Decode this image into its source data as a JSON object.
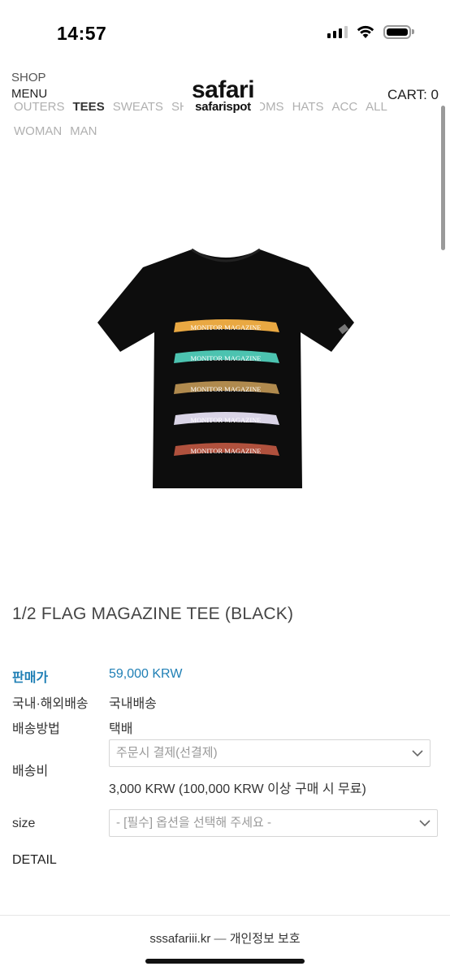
{
  "status_bar": {
    "time": "14:57",
    "icons": [
      "signal-icon",
      "wifi-icon",
      "battery-icon"
    ]
  },
  "header": {
    "shop_label": "SHOP",
    "menu_label": "MENU",
    "logo_main": "safari",
    "logo_sub": "safarispot",
    "cart_label": "CART: 0"
  },
  "nav": {
    "categories": [
      "OUTERS",
      "TEES",
      "SWEATS",
      "SHIRTS",
      "BOTTOMS",
      "HATS",
      "ACC",
      "ALL"
    ],
    "active_category": "TEES",
    "genders": [
      "WOMAN",
      "MAN"
    ]
  },
  "product": {
    "title": "1/2 FLAG MAGAZINE TEE (BLACK)",
    "image_icon": "t-shirt-image",
    "banner_text": "MONITOR MAGAZINE",
    "banner_colors": [
      "#e9a842",
      "#4cc3b0",
      "#b08a4e",
      "#d9d4e6",
      "#b0513d"
    ]
  },
  "info": {
    "price_label": "판매가",
    "price_value": "59,000 KRW",
    "shipping_scope_label": "국내·해외배송",
    "shipping_scope_value": "국내배송",
    "shipping_method_label": "배송방법",
    "shipping_method_value": "택배",
    "shipping_fee_label": "배송비",
    "shipping_fee_select": "주문시 결제(선결제)",
    "shipping_fee_note": "3,000 KRW (100,000 KRW 이상 구매 시 무료)",
    "size_label": "size",
    "size_select": "- [필수] 옵션을 선택해 주세요 -",
    "detail_label": "DETAIL"
  },
  "footer": {
    "domain": "sssafariii.kr",
    "separator": "—",
    "privacy_link": "개인정보 보호"
  },
  "colors": {
    "accent": "#1f7fb5",
    "shirt": "#0d0d0d"
  }
}
